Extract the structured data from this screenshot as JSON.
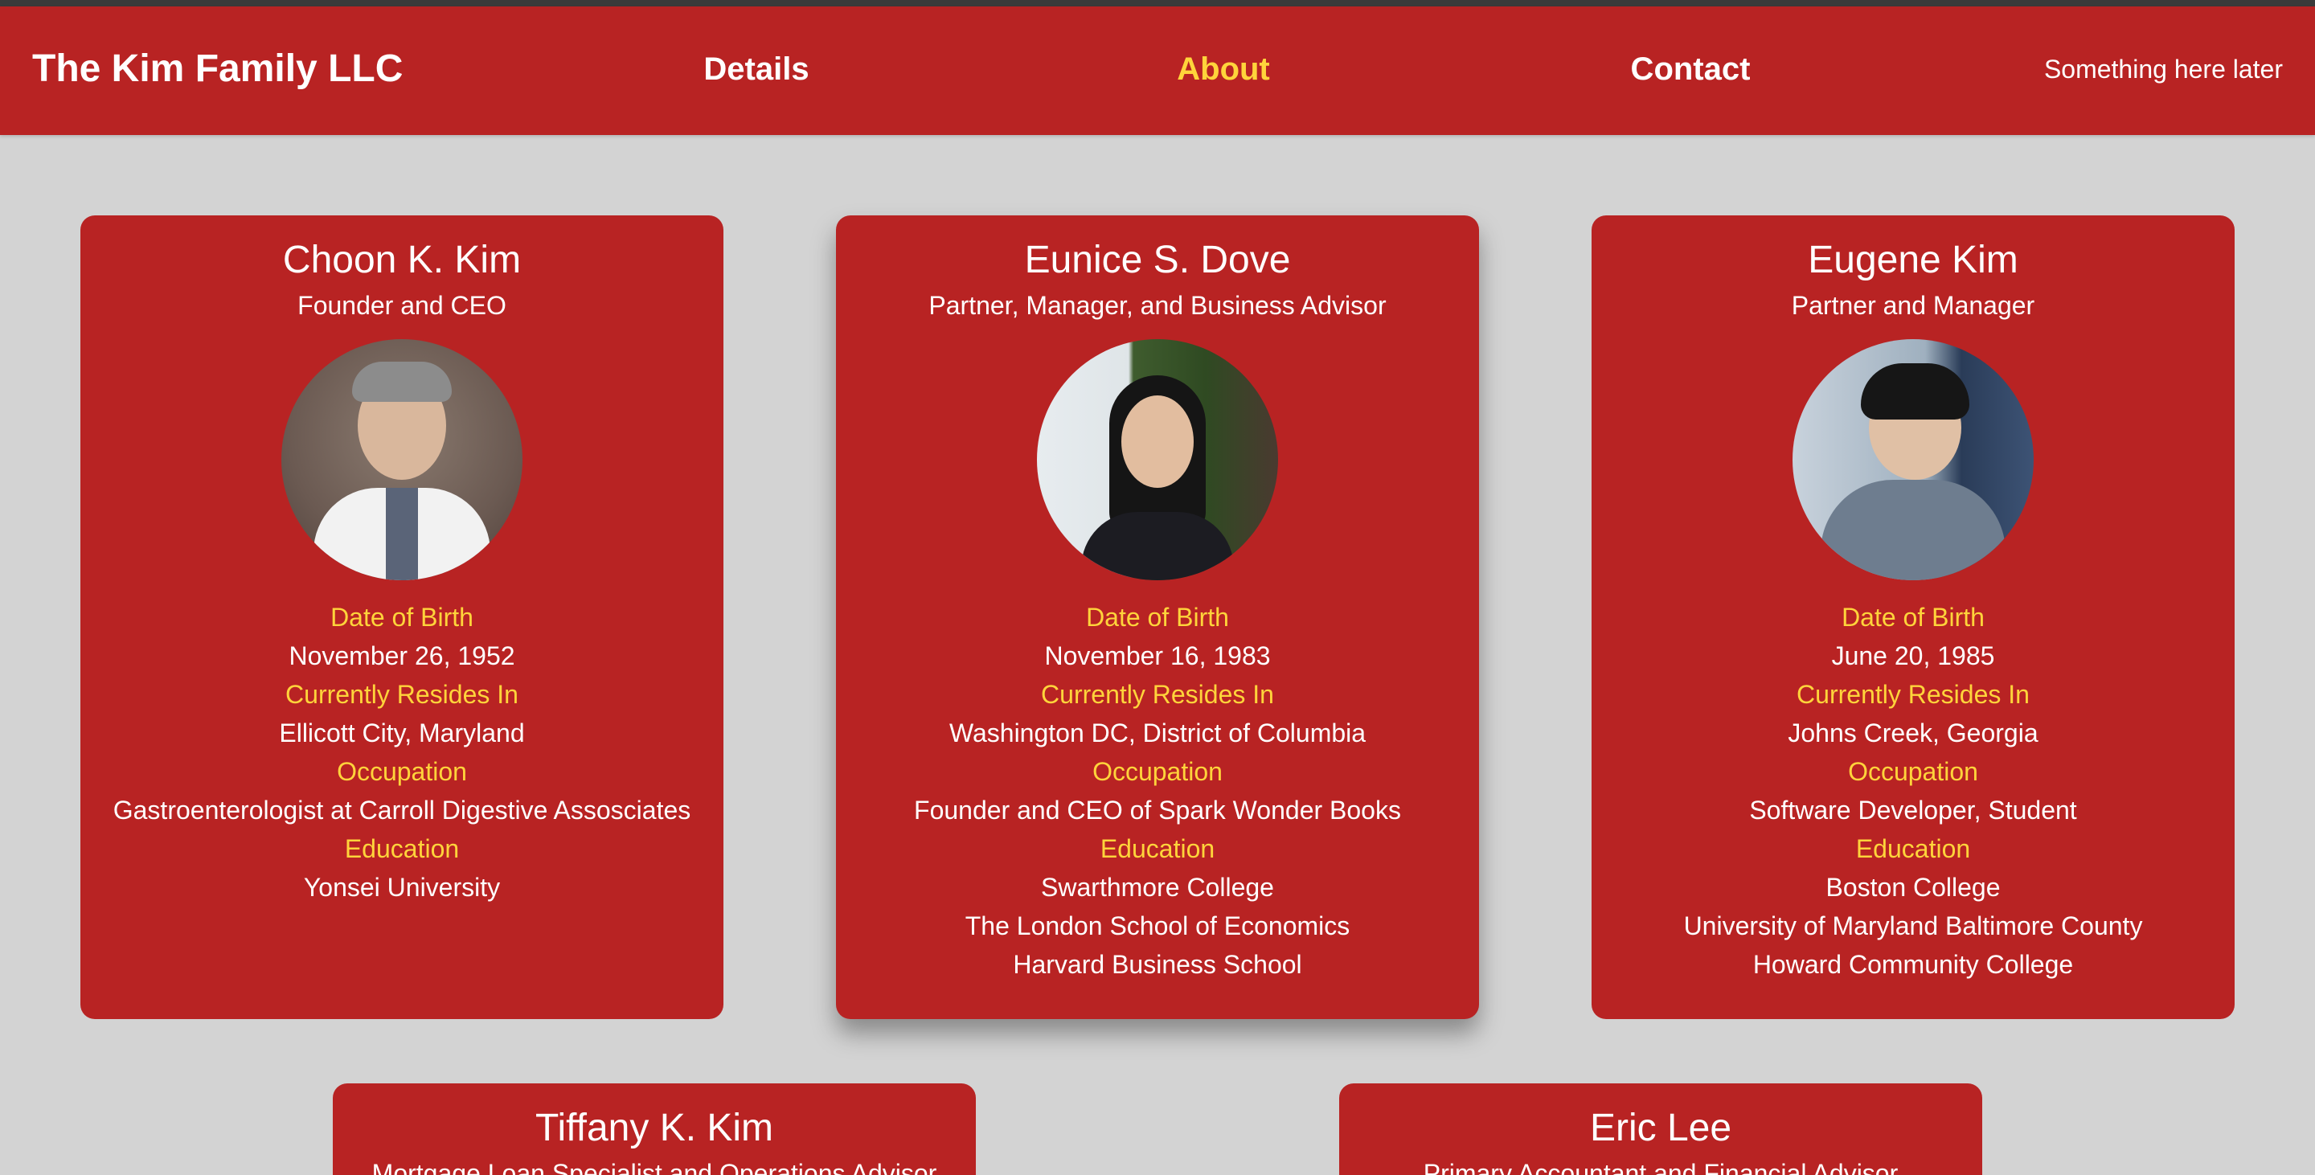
{
  "nav": {
    "brand": "The Kim Family LLC",
    "links": [
      {
        "label": "Details",
        "active": false
      },
      {
        "label": "About",
        "active": true
      },
      {
        "label": "Contact",
        "active": false
      }
    ],
    "extra": "Something here later"
  },
  "labels": {
    "dob": "Date of Birth",
    "resides": "Currently Resides In",
    "occupation": "Occupation",
    "education": "Education"
  },
  "members": [
    {
      "name": "Choon K. Kim",
      "role": "Founder and CEO",
      "dob": "November 26, 1952",
      "resides": "Ellicott City, Maryland",
      "occupation": "Gastroenterologist at Carroll Digestive Assosciates",
      "education": [
        "Yonsei University"
      ]
    },
    {
      "name": "Eunice S. Dove",
      "role": "Partner, Manager, and Business Advisor",
      "dob": "November 16, 1983",
      "resides": "Washington DC, District of Columbia",
      "occupation": "Founder and CEO of Spark Wonder Books",
      "education": [
        "Swarthmore College",
        "The London School of Economics",
        "Harvard Business School"
      ]
    },
    {
      "name": "Eugene Kim",
      "role": "Partner and Manager",
      "dob": "June 20, 1985",
      "resides": "Johns Creek, Georgia",
      "occupation": "Software Developer, Student",
      "education": [
        "Boston College",
        "University of Maryland Baltimore County",
        "Howard Community College"
      ]
    },
    {
      "name": "Tiffany K. Kim",
      "role": "Mortgage Loan Specialist and Operations Advisor"
    },
    {
      "name": "Eric Lee",
      "role": "Primary Accountant and Financial Advisor"
    }
  ],
  "colors": {
    "primary": "#b82323",
    "accent": "#ffd43b",
    "background": "#d3d3d3"
  }
}
